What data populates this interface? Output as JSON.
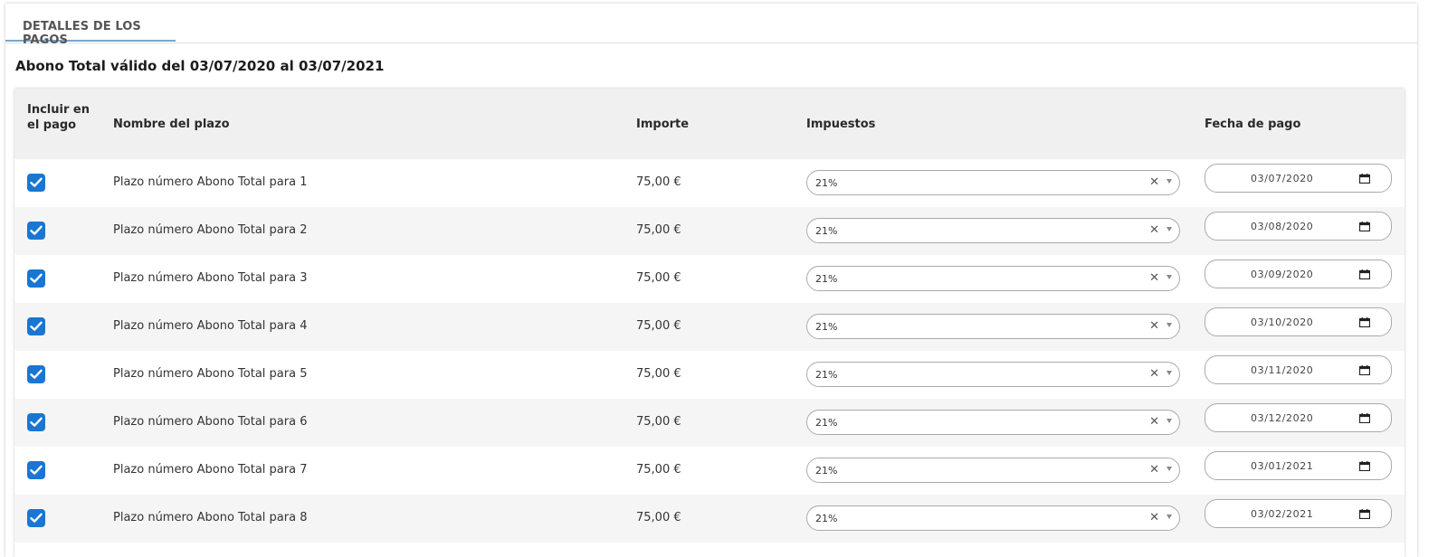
{
  "tab": {
    "label": "DETALLES DE LOS PAGOS"
  },
  "validity": "Abono Total válido del 03/07/2020 al 03/07/2021",
  "columns": {
    "incluir": "Incluir en el pago",
    "nombre": "Nombre del plazo",
    "importe": "Importe",
    "impuestos": "Impuestos",
    "fecha": "Fecha de pago"
  },
  "colors": {
    "checkbox": "#1976d2",
    "tab_underline": "#7aa6c8"
  },
  "rows": [
    {
      "checked": true,
      "nombre": "Plazo número Abono Total para 1",
      "importe": "75,00 €",
      "impuesto": "21%",
      "fecha": "03/07/2020"
    },
    {
      "checked": true,
      "nombre": "Plazo número Abono Total para 2",
      "importe": "75,00 €",
      "impuesto": "21%",
      "fecha": "03/08/2020"
    },
    {
      "checked": true,
      "nombre": "Plazo número Abono Total para 3",
      "importe": "75,00 €",
      "impuesto": "21%",
      "fecha": "03/09/2020"
    },
    {
      "checked": true,
      "nombre": "Plazo número Abono Total para 4",
      "importe": "75,00 €",
      "impuesto": "21%",
      "fecha": "03/10/2020"
    },
    {
      "checked": true,
      "nombre": "Plazo número Abono Total para 5",
      "importe": "75,00 €",
      "impuesto": "21%",
      "fecha": "03/11/2020"
    },
    {
      "checked": true,
      "nombre": "Plazo número Abono Total para 6",
      "importe": "75,00 €",
      "impuesto": "21%",
      "fecha": "03/12/2020"
    },
    {
      "checked": true,
      "nombre": "Plazo número Abono Total para 7",
      "importe": "75,00 €",
      "impuesto": "21%",
      "fecha": "03/01/2021"
    },
    {
      "checked": true,
      "nombre": "Plazo número Abono Total para 8",
      "importe": "75,00 €",
      "impuesto": "21%",
      "fecha": "03/02/2021"
    }
  ]
}
